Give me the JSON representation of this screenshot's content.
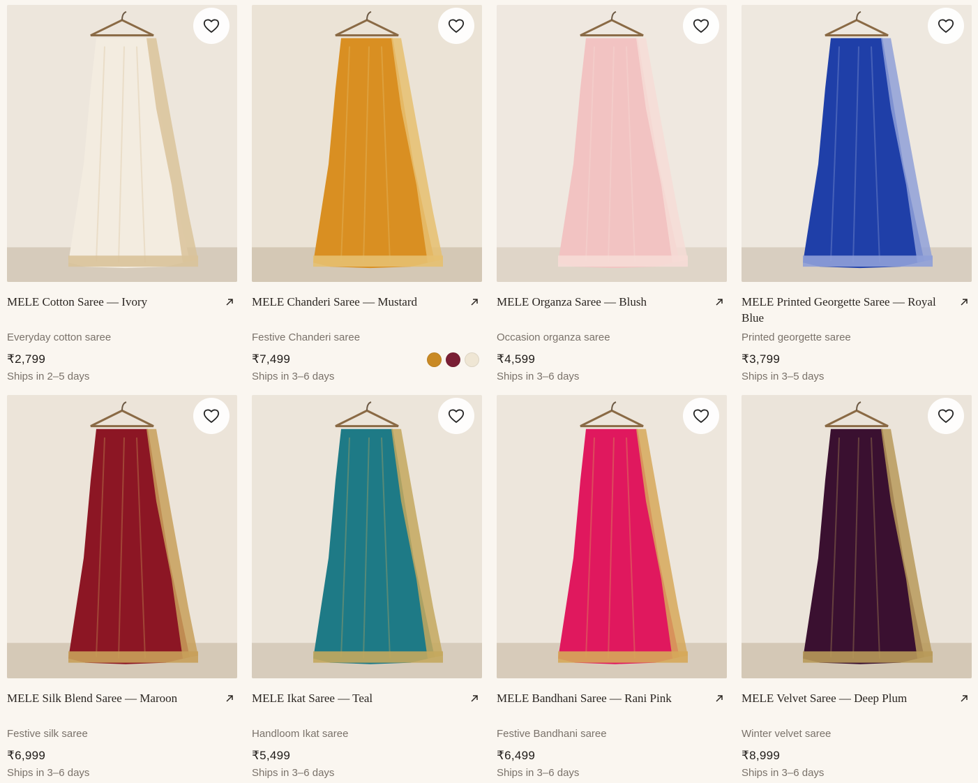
{
  "products": [
    {
      "title": "MELE Cotton Saree — Ivory",
      "subtitle": "Everyday cotton saree",
      "price": "₹2,799",
      "shipping": "Ships in 2–5 days",
      "colors": {
        "saree": "#f3ece0",
        "border": "#d9c39a",
        "wall": "#ede6dc",
        "floor": "#d6cbbb"
      },
      "swatches": []
    },
    {
      "title": "MELE Chanderi Saree — Mustard",
      "subtitle": "Festive Chanderi saree",
      "price": "₹7,499",
      "shipping": "Ships in 3–6 days",
      "colors": {
        "saree": "#d98f22",
        "border": "#e6c070",
        "wall": "#ebe3d6",
        "floor": "#d4c8b5"
      },
      "swatches": [
        "#c98a25",
        "#7a1f35",
        "#efe6d4"
      ]
    },
    {
      "title": "MELE Organza Saree — Blush",
      "subtitle": "Occasion organza saree",
      "price": "₹4,599",
      "shipping": "Ships in 3–6 days",
      "colors": {
        "saree": "#f2c3c2",
        "border": "#f6dcd6",
        "wall": "#efe8e0",
        "floor": "#dfd5c8"
      },
      "swatches": []
    },
    {
      "title": "MELE Printed Georgette Saree — Royal Blue",
      "subtitle": "Printed georgette saree",
      "price": "₹3,799",
      "shipping": "Ships in 3–5 days",
      "colors": {
        "saree": "#1f3fa8",
        "border": "#8fa0d8",
        "wall": "#eee8df",
        "floor": "#d8cec0"
      },
      "swatches": []
    },
    {
      "title": "MELE Silk Blend Saree — Maroon",
      "subtitle": "Festive silk saree",
      "price": "₹6,999",
      "shipping": "Ships in 3–6 days",
      "colors": {
        "saree": "#8c1624",
        "border": "#c8a05a",
        "wall": "#ece4d9",
        "floor": "#d5c9b7"
      },
      "swatches": []
    },
    {
      "title": "MELE Ikat Saree — Teal",
      "subtitle": "Handloom Ikat saree",
      "price": "₹5,499",
      "shipping": "Ships in 3–6 days",
      "colors": {
        "saree": "#1e7a86",
        "border": "#c4a85e",
        "wall": "#ece5da",
        "floor": "#d7ccbc"
      },
      "swatches": []
    },
    {
      "title": "MELE Bandhani Saree — Rani Pink",
      "subtitle": "Festive Bandhani saree",
      "price": "₹6,499",
      "shipping": "Ships in 3–6 days",
      "colors": {
        "saree": "#e0185e",
        "border": "#d6a85a",
        "wall": "#ede6dc",
        "floor": "#d7cbba"
      },
      "swatches": []
    },
    {
      "title": "MELE Velvet Saree — Deep Plum",
      "subtitle": "Winter velvet saree",
      "price": "₹8,999",
      "shipping": "Ships in 3–6 days",
      "colors": {
        "saree": "#3a1030",
        "border": "#b89a5a",
        "wall": "#ebe4da",
        "floor": "#d4c8b6"
      },
      "swatches": []
    }
  ],
  "icons": {
    "wishlist": "heart-outline-icon",
    "open": "arrow-up-right-icon"
  }
}
